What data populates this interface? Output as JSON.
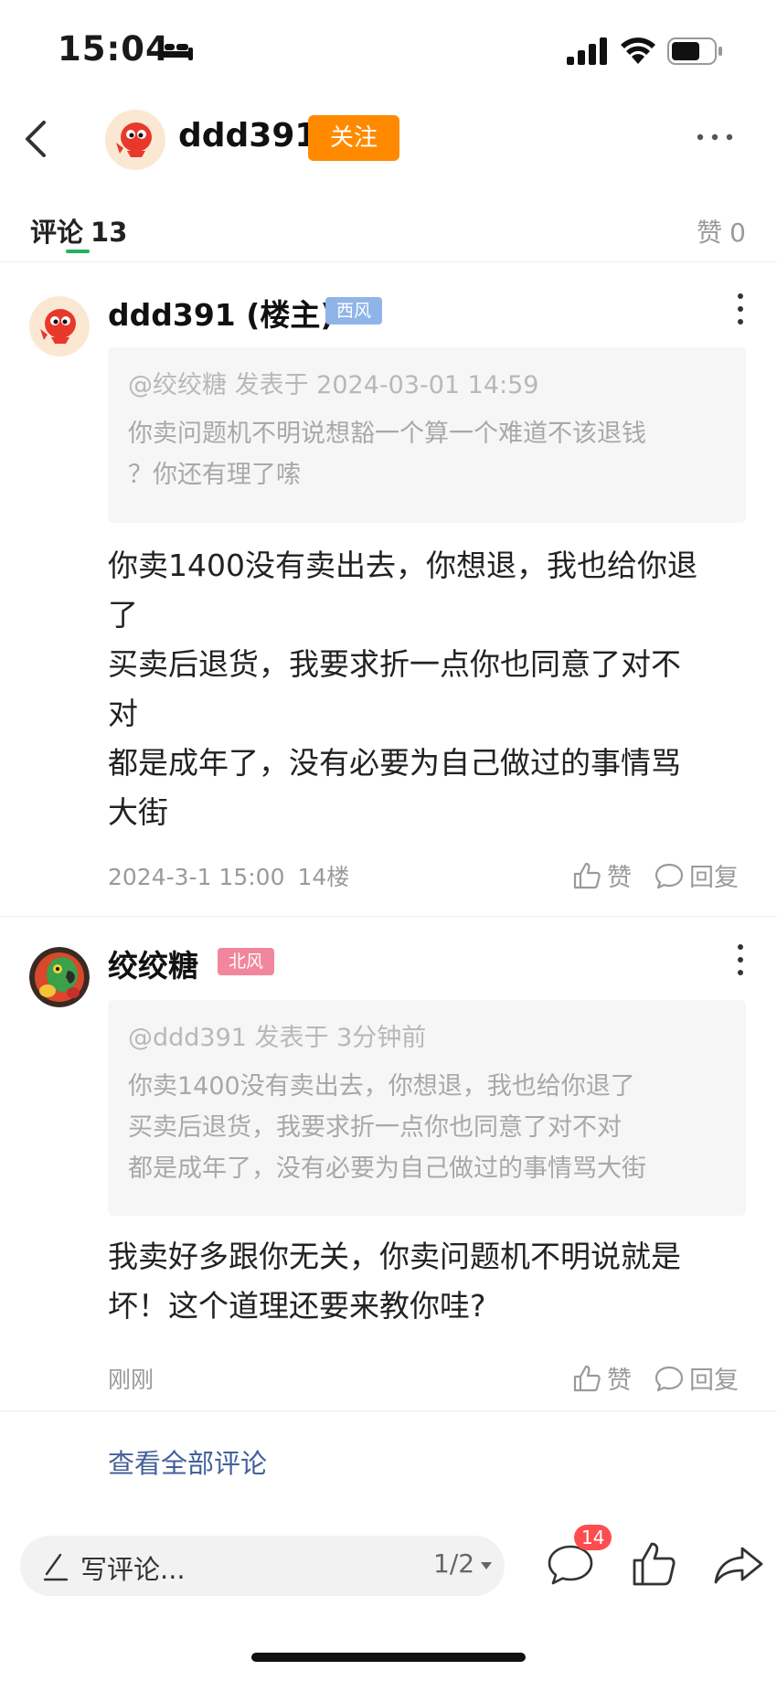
{
  "status_bar": {
    "time": "15:04"
  },
  "header": {
    "username": "ddd391",
    "follow_label": "关注"
  },
  "tabs": {
    "comments_label": "评论",
    "comments_count": "13",
    "likes_label": "赞",
    "likes_count": "0"
  },
  "comments": [
    {
      "author": "ddd391 (楼主)",
      "badge": "西风",
      "badge_color": "#8fb4e8",
      "quote_head": "@绞绞糖 发表于 2024-03-01 14:59",
      "quote_body": "你卖问题机不明说想豁一个算一个难道不该退钱\n？你还有理了嗦",
      "body": "你卖1400没有卖出去，你想退，我也给你退\n了\n买卖后退货，我要求折一点你也同意了对不\n对\n都是成年了，没有必要为自己做过的事情骂\n大街",
      "time": "2024-3-1 15:00",
      "floor": "14楼",
      "like_label": "赞",
      "reply_label": "回复"
    },
    {
      "author": "绞绞糖",
      "badge": "北风",
      "badge_color": "#f2869d",
      "quote_head": "@ddd391 发表于 3分钟前",
      "quote_body": "你卖1400没有卖出去，你想退，我也给你退了\n买卖后退货，我要求折一点你也同意了对不对\n都是成年了，没有必要为自己做过的事情骂大街",
      "body": "我卖好多跟你无关，你卖问题机不明说就是\n坏！这个道理还要来教你哇?",
      "time": "刚刚",
      "floor": "",
      "like_label": "赞",
      "reply_label": "回复"
    }
  ],
  "view_all_label": "查看全部评论",
  "bottom_bar": {
    "input_placeholder": "写评论...",
    "page_indicator": "1/2",
    "comment_count": "14"
  }
}
